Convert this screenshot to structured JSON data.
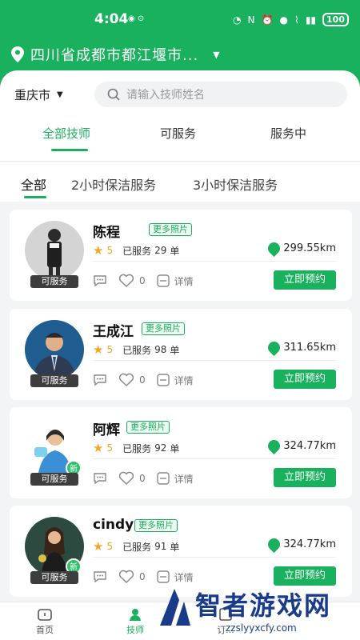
{
  "status": {
    "time": "4:04",
    "battery": "100"
  },
  "location": {
    "text": "四川省成都市都江堰市..."
  },
  "city": "重庆市",
  "search": {
    "placeholder": "请输入技师姓名"
  },
  "tabs": [
    "全部技师",
    "可服务",
    "服务中"
  ],
  "subtabs": [
    "全部",
    "2小时保洁服务",
    "3小时保洁服务"
  ],
  "more_label": "更多照片",
  "book_label": "立即预约",
  "detail_label": "详情",
  "rating_label": "已服务",
  "unit": "单",
  "cards": [
    {
      "name": "陈程",
      "rating": "5",
      "served": "29",
      "distance": "299.55km",
      "likes": "0",
      "status": "可服务",
      "is_new": false
    },
    {
      "name": "王成江",
      "rating": "5",
      "served": "98",
      "distance": "311.65km",
      "likes": "0",
      "status": "可服务",
      "is_new": false
    },
    {
      "name": "阿辉",
      "rating": "5",
      "served": "92",
      "distance": "324.77km",
      "likes": "0",
      "status": "可服务",
      "is_new": true
    },
    {
      "name": "cindy",
      "rating": "5",
      "served": "91",
      "distance": "324.77km",
      "likes": "0",
      "status": "可服务",
      "is_new": true
    }
  ],
  "new_badge": "新",
  "bottom_nav": [
    "首页",
    "技师",
    "订..."
  ],
  "watermark": {
    "title": "智者游戏网",
    "url": "zzslyyxcfy.com"
  },
  "colors": {
    "primary": "#19b15d"
  }
}
